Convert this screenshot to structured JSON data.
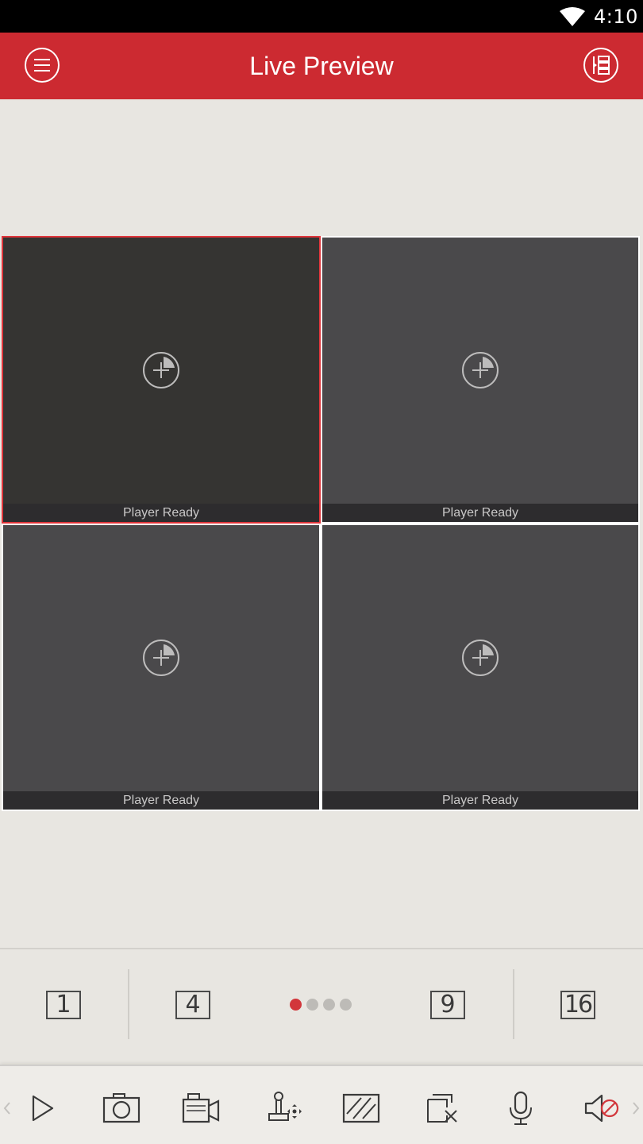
{
  "status_bar": {
    "time": "4:10",
    "wifi_icon": "wifi-icon"
  },
  "app_bar": {
    "title": "Live Preview",
    "menu_icon": "menu-icon",
    "list_icon": "device-list-icon",
    "color": "#cc2a31"
  },
  "tiles": [
    {
      "status": "Player Ready",
      "selected": true,
      "icon": "add-camera-icon"
    },
    {
      "status": "Player Ready",
      "selected": false,
      "icon": "add-camera-icon"
    },
    {
      "status": "Player Ready",
      "selected": false,
      "icon": "add-camera-icon"
    },
    {
      "status": "Player Ready",
      "selected": false,
      "icon": "add-camera-icon"
    }
  ],
  "split_modes": {
    "one": "1",
    "four": "4",
    "nine": "9",
    "sixteen": "16"
  },
  "pager": {
    "count": 4,
    "active_index": 0,
    "active_color": "#d2363b"
  },
  "toolbar": {
    "items": [
      "play-icon",
      "snapshot-icon",
      "record-icon",
      "ptz-icon",
      "quality-icon",
      "close-all-icon",
      "microphone-icon",
      "audio-mute-icon"
    ]
  }
}
